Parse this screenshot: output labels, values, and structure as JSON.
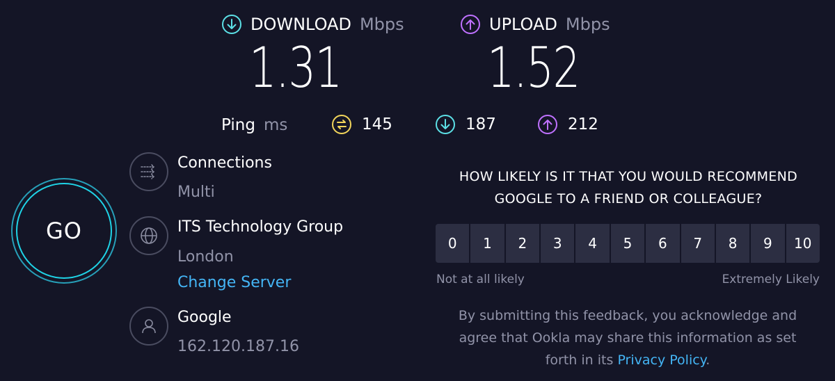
{
  "download": {
    "label": "DOWNLOAD",
    "unit": "Mbps",
    "value": "1.31",
    "icon": "download-icon",
    "color": "#5ce0e6"
  },
  "upload": {
    "label": "UPLOAD",
    "unit": "Mbps",
    "value": "1.52",
    "icon": "upload-icon",
    "color": "#bf71ff"
  },
  "ping": {
    "label": "Ping",
    "unit": "ms",
    "idle": {
      "value": "145",
      "icon": "ping-idle-icon",
      "color": "#f2d55b"
    },
    "down": {
      "value": "187",
      "icon": "ping-download-icon",
      "color": "#5ce0e6"
    },
    "up": {
      "value": "212",
      "icon": "ping-upload-icon",
      "color": "#bf71ff"
    }
  },
  "go_button": {
    "label": "GO"
  },
  "connections": {
    "title": "Connections",
    "value": "Multi",
    "icon": "connections-icon"
  },
  "server": {
    "title": "ITS Technology Group",
    "location": "London",
    "change_link": "Change Server",
    "icon": "globe-icon"
  },
  "provider": {
    "title": "Google",
    "ip": "162.120.187.16",
    "icon": "user-icon"
  },
  "survey": {
    "question_line1": "HOW LIKELY IS IT THAT YOU WOULD RECOMMEND",
    "question_line2": "GOOGLE TO A FRIEND OR COLLEAGUE?",
    "options": [
      "0",
      "1",
      "2",
      "3",
      "4",
      "5",
      "6",
      "7",
      "8",
      "9",
      "10"
    ],
    "low_label": "Not at all likely",
    "high_label": "Extremely Likely",
    "disclaimer_line1": "By submitting this feedback, you acknowledge and",
    "disclaimer_line2": "agree that Ookla may share this information as set",
    "disclaimer_prefix": "forth in its",
    "privacy_link": "Privacy Policy",
    "disclaimer_suffix": "."
  }
}
